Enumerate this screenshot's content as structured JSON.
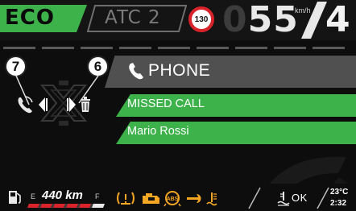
{
  "status_bar": {
    "riding_mode": "ECO",
    "traction_control": "ATC 2",
    "speed_limit": "130",
    "speed_dim_digit": "0",
    "speed_value": "55",
    "speed_unit": "km/h",
    "gear": "4"
  },
  "controls": {
    "left_hint": "7",
    "right_hint": "6",
    "left_icon": "call-back-icon",
    "right_icon": "trash-icon"
  },
  "menu": {
    "title_icon": "phone-icon",
    "title": "PHONE",
    "items": [
      {
        "label": "MISSED CALL"
      },
      {
        "label": "Mario Rossi"
      }
    ]
  },
  "bottom_bar": {
    "fuel_empty_label": "E",
    "range": "440 km",
    "fuel_full_label": "F",
    "warning_icons": [
      "tyre-pressure-warning-icon",
      "engine-warning-icon",
      "abs-warning-icon",
      "service-wrench-icon",
      "oil-temperature-icon"
    ],
    "ice_status": "OK",
    "temperature": "23°C",
    "time": "2:32"
  },
  "colors": {
    "accent_green": "#3db14a",
    "speed_limit_red": "#d8232a",
    "warning_amber": "#f5a623",
    "fuel_bar_red": "#d8232a"
  }
}
